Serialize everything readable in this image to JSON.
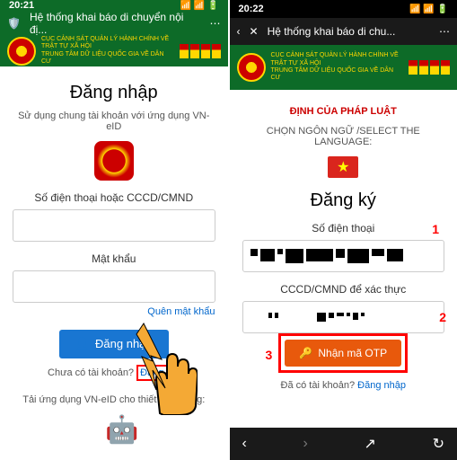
{
  "left": {
    "time": "20:21",
    "header_title": "Hệ thống khai báo di chuyển nội đị...",
    "banner_line1": "CỤC CẢNH SÁT QUẢN LÝ HÀNH CHÍNH VỀ TRẬT TỰ XÃ HỘI",
    "banner_line2": "TRUNG TÂM DỮ LIỆU QUỐC GIA VỀ DÂN CƯ",
    "title": "Đăng nhập",
    "subtitle": "Sử dụng chung tài khoản với ứng dụng VN-eID",
    "phone_label": "Số điện thoại hoặc CCCD/CMND",
    "password_label": "Mật khẩu",
    "forgot": "Quên mật khẩu",
    "login_btn": "Đăng nhập",
    "noacct": "Chưa có tài khoản?",
    "signup_link": "Đăng ký",
    "download": "Tải ứng dụng VN-eID cho thiết bị di động:"
  },
  "right": {
    "time": "20:22",
    "header_title": "Hệ thống khai báo di chu...",
    "red_text": "ĐỊNH CỦA PHÁP LUẬT",
    "lang_text": "CHỌN NGÔN NGỮ /SELECT THE LANGUAGE:",
    "title": "Đăng ký",
    "phone_label": "Số điện thoại",
    "id_label": "CCCD/CMND để xác thực",
    "otp_btn": "Nhận mã OTP",
    "has_acct": "Đã có tài khoản?",
    "login_link": "Đăng nhập",
    "num1": "1",
    "num2": "2",
    "num3": "3"
  }
}
